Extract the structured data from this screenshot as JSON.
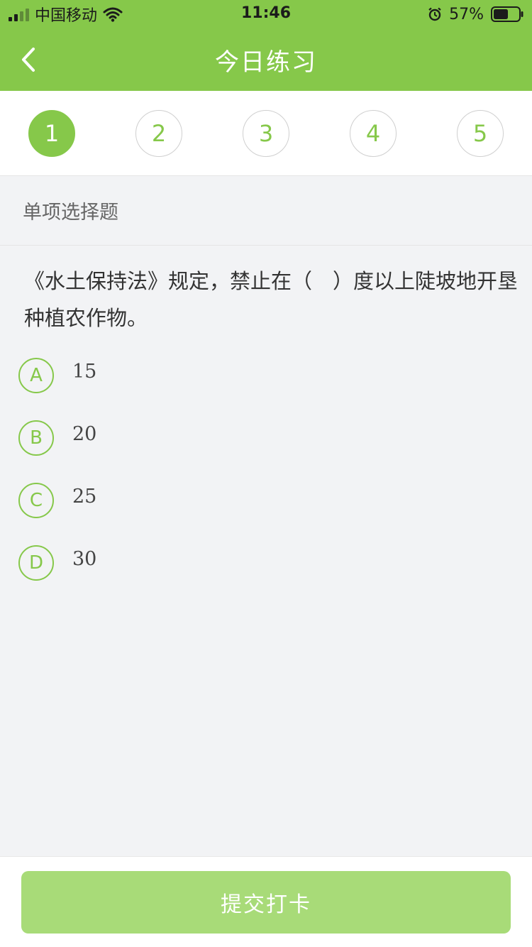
{
  "status_bar": {
    "carrier": "中国移动",
    "time": "11:46",
    "battery": "57%"
  },
  "nav": {
    "title": "今日练习"
  },
  "steps": [
    "1",
    "2",
    "3",
    "4",
    "5"
  ],
  "active_step": 1,
  "question": {
    "type": "单项选择题",
    "stem": "《水土保持法》规定，禁止在（　）度以上陡坡地开垦种植农作物。",
    "options": [
      {
        "letter": "A",
        "text": "15"
      },
      {
        "letter": "B",
        "text": "20"
      },
      {
        "letter": "C",
        "text": "25"
      },
      {
        "letter": "D",
        "text": "30"
      }
    ]
  },
  "footer": {
    "submit_label": "提交打卡"
  },
  "colors": {
    "accent": "#86c84a",
    "submit_disabled": "#a8db78",
    "background": "#f2f3f5"
  }
}
